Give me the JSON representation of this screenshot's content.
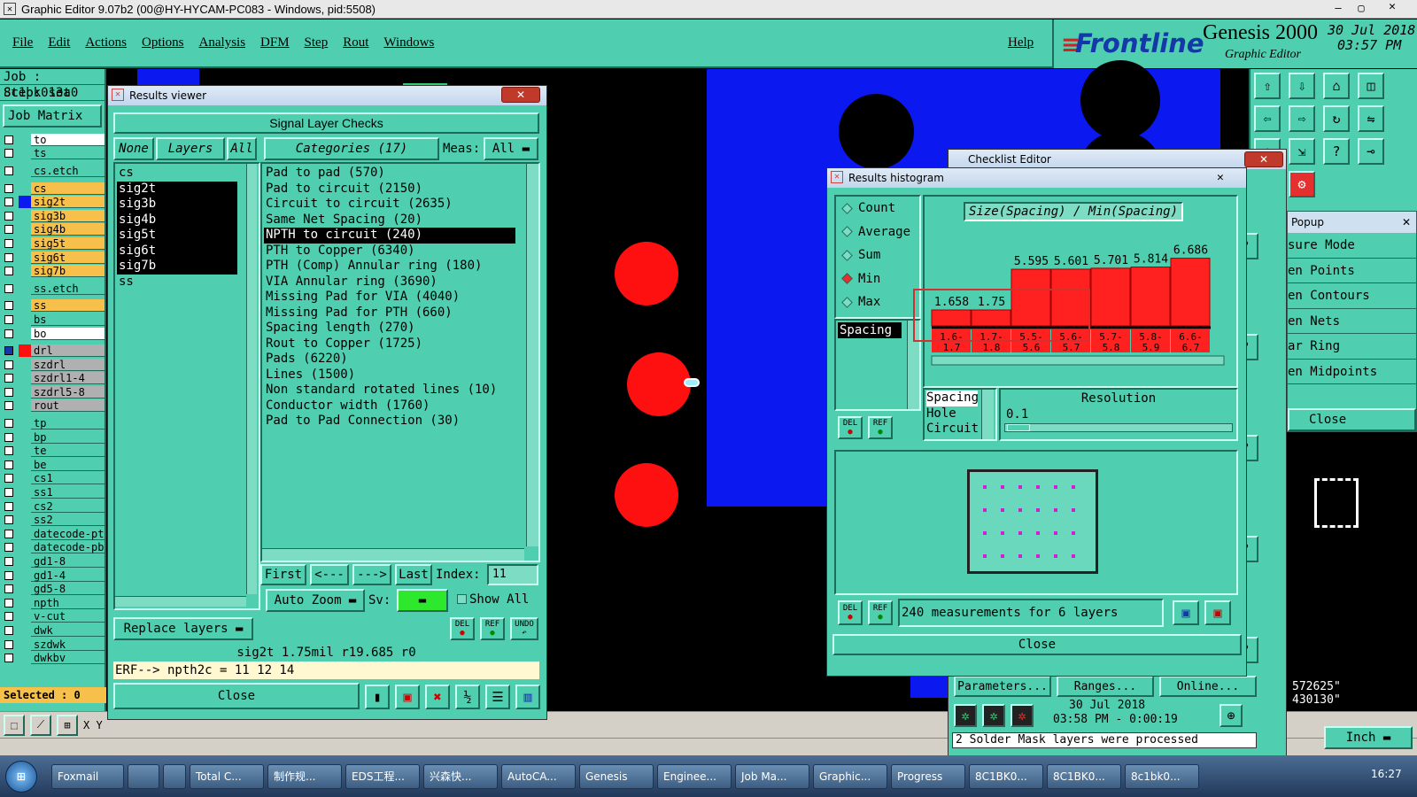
{
  "window": {
    "title": "Graphic Editor 9.07b2 (00@HY-HYCAM-PC083 - Windows, pid:5508)"
  },
  "menu": [
    "File",
    "Edit",
    "Actions",
    "Options",
    "Analysis",
    "DFM",
    "Step",
    "Rout",
    "Windows"
  ],
  "help": "Help",
  "brand": {
    "logo": "Frontline",
    "product": "Genesis 2000",
    "sub": "Graphic Editor",
    "date": "30 Jul 2018",
    "time": "03:57 PM"
  },
  "job": {
    "job": "Job : 8c1bk013a0",
    "step": "Step: set",
    "matrix": "Job Matrix"
  },
  "layers": [
    {
      "name": "to",
      "color": "#ffffff"
    },
    {
      "name": "ts",
      "color": "#4fcfb0"
    },
    {
      "name": "cs.etch",
      "color": "#4fcfb0"
    },
    {
      "name": "cs",
      "color": "#f7c04a"
    },
    {
      "name": "sig2t",
      "color": "#f7c04a"
    },
    {
      "name": "sig3b",
      "color": "#f7c04a"
    },
    {
      "name": "sig4b",
      "color": "#f7c04a"
    },
    {
      "name": "sig5t",
      "color": "#f7c04a"
    },
    {
      "name": "sig6t",
      "color": "#f7c04a"
    },
    {
      "name": "sig7b",
      "color": "#f7c04a"
    },
    {
      "name": "ss.etch",
      "color": "#4fcfb0"
    },
    {
      "name": "ss",
      "color": "#f7c04a"
    },
    {
      "name": "bs",
      "color": "#4fcfb0"
    },
    {
      "name": "bo",
      "color": "#ffffff"
    },
    {
      "name": "drl",
      "color": "#b0b0b0"
    },
    {
      "name": "szdrl",
      "color": "#b0b0b0"
    },
    {
      "name": "szdrl1-4",
      "color": "#b0b0b0"
    },
    {
      "name": "szdrl5-8",
      "color": "#b0b0b0"
    },
    {
      "name": "rout",
      "color": "#b0b0b0"
    },
    {
      "name": "tp",
      "color": "#4fcfb0"
    },
    {
      "name": "bp",
      "color": "#4fcfb0"
    },
    {
      "name": "te",
      "color": "#4fcfb0"
    },
    {
      "name": "be",
      "color": "#4fcfb0"
    },
    {
      "name": "cs1",
      "color": "#4fcfb0"
    },
    {
      "name": "ss1",
      "color": "#4fcfb0"
    },
    {
      "name": "cs2",
      "color": "#4fcfb0"
    },
    {
      "name": "ss2",
      "color": "#4fcfb0"
    },
    {
      "name": "datecode-pt",
      "color": "#4fcfb0"
    },
    {
      "name": "datecode-pb",
      "color": "#4fcfb0"
    },
    {
      "name": "gd1-8",
      "color": "#4fcfb0"
    },
    {
      "name": "gd1-4",
      "color": "#4fcfb0"
    },
    {
      "name": "gd5-8",
      "color": "#4fcfb0"
    },
    {
      "name": "npth",
      "color": "#4fcfb0"
    },
    {
      "name": "v-cut",
      "color": "#4fcfb0"
    },
    {
      "name": "dwk",
      "color": "#4fcfb0"
    },
    {
      "name": "szdwk",
      "color": "#4fcfb0"
    },
    {
      "name": "dwkbv",
      "color": "#4fcfb0"
    }
  ],
  "selected": "Selected : 0",
  "coord_label": "X Y",
  "results_viewer": {
    "title": "Results viewer",
    "header": "Signal Layer Checks",
    "none": "None",
    "layers_btn": "Layers",
    "all": "All",
    "categories_btn": "Categories (17)",
    "meas_label": "Meas:",
    "meas_value": "All",
    "layer_list": [
      "cs",
      "sig2t",
      "sig3b",
      "sig4b",
      "sig5t",
      "sig6t",
      "sig7b",
      "ss"
    ],
    "categories": [
      "Pad to pad (570)",
      "Pad to circuit (2150)",
      "Circuit to circuit (2635)",
      "Same Net Spacing (20)",
      "NPTH to circuit (240)",
      "PTH to Copper (6340)",
      "PTH (Comp) Annular ring (180)",
      "VIA Annular ring (3690)",
      "Missing Pad for VIA (4040)",
      "Missing Pad for PTH (660)",
      "Spacing length (270)",
      "Rout to Copper (1725)",
      "Pads (6220)",
      "Lines (1500)",
      "Non standard rotated lines (10)",
      "Conductor width (1760)",
      "Pad to Pad Connection (30)"
    ],
    "first": "First",
    "prev": "<---",
    "next": "--->",
    "last": "Last",
    "index_label": "Index:",
    "index_value": "11",
    "auto_zoom": "Auto Zoom",
    "sv": "Sv:",
    "show_all": "Show All",
    "replace": "Replace layers",
    "del": "DEL",
    "ref": "REF",
    "undo": "UNDO",
    "status": "sig2t 1.75mil  r19.685  r0",
    "erf": "ERF--> npth2c = 11 12 14",
    "close": "Close"
  },
  "histogram": {
    "title": "Results histogram",
    "options": [
      "Count",
      "Average",
      "Sum",
      "Min",
      "Max"
    ],
    "selected_option": "Min",
    "list_item": "Spacing",
    "chart_title": "Size(Spacing) / Min(Spacing)",
    "resolution_label": "Resolution",
    "resolution_value": "0.1",
    "metrics": [
      "Spacing",
      "Hole",
      "Circuit"
    ],
    "measurements": "240 measurements for 6 layers",
    "close": "Close",
    "del": "DEL",
    "ref": "REF"
  },
  "chart_data": {
    "type": "bar",
    "title": "Size(Spacing) / Min(Spacing)",
    "categories": [
      "1.6-1.7",
      "1.7-1.8",
      "5.5-5.6",
      "5.6-5.7",
      "5.7-5.8",
      "5.8-5.9",
      "6.6-6.7"
    ],
    "values": [
      1.658,
      1.75,
      5.595,
      5.601,
      5.701,
      5.814,
      6.686
    ],
    "labels": [
      "1.658",
      "1.75",
      "5.595",
      "5.601",
      "5.701",
      "5.814",
      "6.686"
    ],
    "bar_color": "#ff2020"
  },
  "checklist": {
    "title": "Checklist Editor",
    "popup": "Popup",
    "popup_items": [
      "sure Mode",
      "en Points",
      "en Contours",
      "en Nets",
      "ar Ring",
      "en Midpoints"
    ],
    "close": "Close",
    "coords": [
      "572625\"",
      "430130\""
    ],
    "parameters": "Parameters...",
    "ranges": "Ranges...",
    "online": "Online...",
    "run_date": "30 Jul 2018",
    "run_time": "03:58 PM - 0:00:19",
    "units": "Inch",
    "message": "2 Solder Mask layers were processed"
  },
  "taskbar": {
    "items": [
      "Foxmail",
      "",
      "",
      "Total C...",
      "制作规...",
      "EDS工程...",
      "兴森快...",
      "AutoCA...",
      "Genesis",
      "Enginee...",
      "Job Ma...",
      "Graphic...",
      "Progress",
      "8C1BK0...",
      "8C1BK0...",
      "8c1bk0..."
    ],
    "clock": "16:27"
  }
}
